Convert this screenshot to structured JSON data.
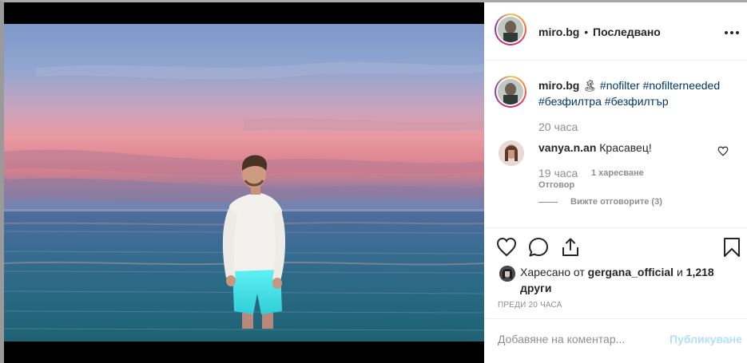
{
  "post": {
    "username": "miro.bg",
    "separator": "•",
    "follow_status": "Последвано",
    "caption": {
      "username": "miro.bg",
      "emoji": "🏝",
      "hashtags": [
        "#nofilter",
        "#nofilterneeded",
        "#безфилтра",
        "#безфилтър"
      ]
    },
    "caption_time": "20 часа"
  },
  "comment": {
    "username": "vanya.n.an",
    "text": "Красавец!",
    "time": "19 часа",
    "likes": "1 харесване",
    "reply_label": "Отговор",
    "view_replies": "Вижте отговорите (3)"
  },
  "likes": {
    "prefix": "Харесано от",
    "user": "gergana_official",
    "conjunction": "и",
    "count": "1,218 други"
  },
  "post_time": "ПРЕДИ 20 ЧАСА",
  "input": {
    "placeholder": "Добавяне на коментар...",
    "publish": "Публикуване"
  },
  "icons": {
    "more": "more-options-icon",
    "like": "heart-icon",
    "comment": "comment-bubble-icon",
    "share": "share-icon",
    "save": "bookmark-icon",
    "comment_like": "small-heart-icon"
  },
  "colors": {
    "link": "#003569",
    "muted": "#8e8e8e",
    "publish_disabled": "#b2dffc",
    "swim_shorts": "#3fe0e6"
  }
}
